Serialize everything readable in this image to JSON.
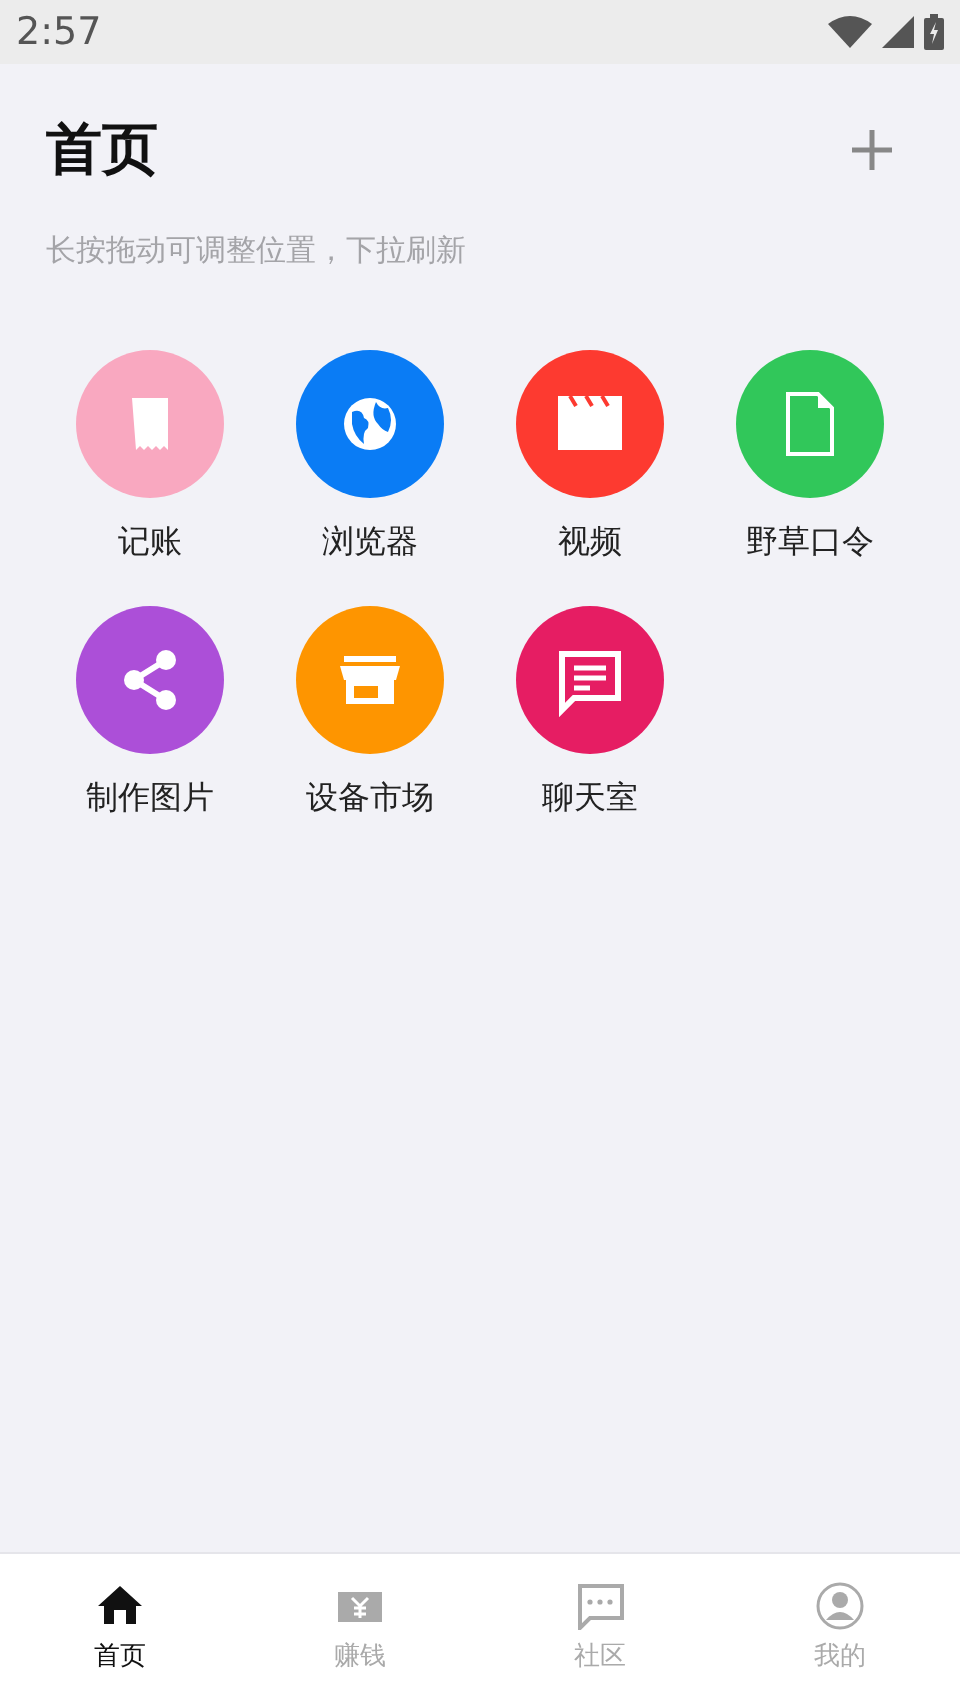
{
  "status_bar": {
    "time": "2:57"
  },
  "header": {
    "title": "首页",
    "hint": "长按拖动可调整位置，下拉刷新"
  },
  "apps": [
    {
      "label": "记账",
      "kind": "receipt",
      "color": "#f9a8c0"
    },
    {
      "label": "浏览器",
      "kind": "globe",
      "color": "#0a7cf5"
    },
    {
      "label": "视频",
      "kind": "clapper",
      "color": "#fd3a30"
    },
    {
      "label": "野草口令",
      "kind": "file",
      "color": "#31c75a"
    },
    {
      "label": "制作图片",
      "kind": "share",
      "color": "#ac4fd8"
    },
    {
      "label": "设备市场",
      "kind": "store",
      "color": "#fe9500"
    },
    {
      "label": "聊天室",
      "kind": "chat",
      "color": "#e61d63"
    }
  ],
  "tabs": [
    {
      "label": "首页",
      "kind": "home",
      "selected": true
    },
    {
      "label": "赚钱",
      "kind": "money",
      "selected": false
    },
    {
      "label": "社区",
      "kind": "chat",
      "selected": false
    },
    {
      "label": "我的",
      "kind": "person",
      "selected": false
    }
  ]
}
